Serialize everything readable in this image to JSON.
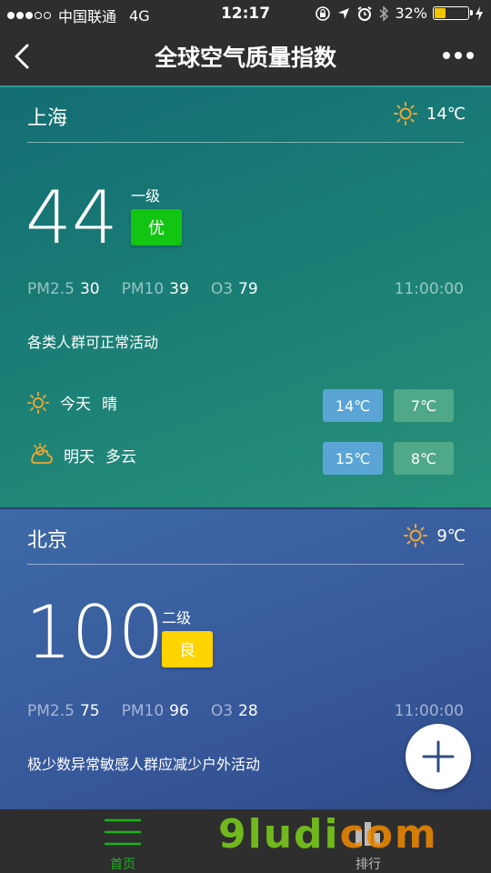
{
  "status_bar": {
    "carrier": "中国联通",
    "network": "4G",
    "time": "12:17",
    "battery": "32%"
  },
  "nav": {
    "title": "全球空气质量指数"
  },
  "cards": [
    {
      "city": "上海",
      "weather_temp": "14℃",
      "aqi": "44",
      "level": "一级",
      "quality": "优",
      "pollutants": [
        {
          "name": "PM2.5",
          "value": "30"
        },
        {
          "name": "PM10",
          "value": "39"
        },
        {
          "name": "O3",
          "value": "79"
        }
      ],
      "time": "11:00:00",
      "advice": "各类人群可正常活动",
      "forecast": [
        {
          "day": "今天",
          "cond": "晴",
          "high": "14℃",
          "low": "7℃"
        },
        {
          "day": "明天",
          "cond": "多云",
          "high": "15℃",
          "low": "8℃"
        }
      ]
    },
    {
      "city": "北京",
      "weather_temp": "9℃",
      "aqi": "100",
      "level": "二级",
      "quality": "良",
      "pollutants": [
        {
          "name": "PM2.5",
          "value": "75"
        },
        {
          "name": "PM10",
          "value": "96"
        },
        {
          "name": "O3",
          "value": "28"
        }
      ],
      "time": "11:00:00",
      "advice": "极少数异常敏感人群应减少户外活动"
    }
  ],
  "tabs": [
    {
      "label": "首页"
    },
    {
      "label": "排行"
    }
  ],
  "watermark": {
    "part1": "9ludi",
    "part2": "com"
  }
}
